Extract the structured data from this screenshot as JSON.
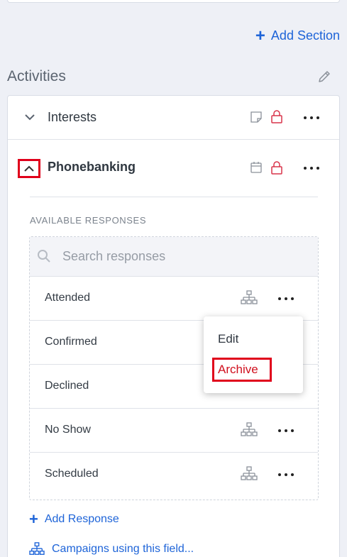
{
  "header": {
    "add_section_label": "Add Section"
  },
  "activities": {
    "heading": "Activities",
    "items": [
      {
        "title": "Interests",
        "type_icon": "note-icon"
      },
      {
        "title": "Phonebanking",
        "type_icon": "calendar-icon"
      }
    ]
  },
  "responses": {
    "section_label": "AVAILABLE RESPONSES",
    "search_placeholder": "Search responses",
    "list": [
      "Attended",
      "Confirmed",
      "Declined",
      "No Show",
      "Scheduled"
    ]
  },
  "context_menu": {
    "edit_label": "Edit",
    "archive_label": "Archive"
  },
  "footer": {
    "add_response_label": "Add Response",
    "campaigns_label": "Campaigns using this field..."
  },
  "colors": {
    "link": "#1e64d8",
    "highlight": "#e0001b",
    "lock": "#d9334a"
  }
}
